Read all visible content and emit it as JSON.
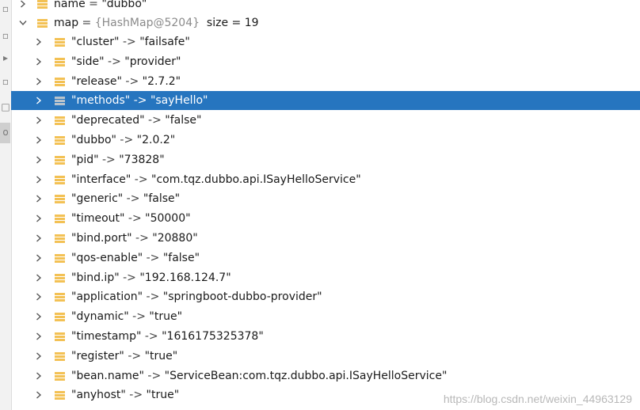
{
  "gutter": {
    "icons": [
      "◻",
      "▸",
      "▫",
      "□",
      "▢",
      "a",
      "o"
    ]
  },
  "top_row": {
    "name": "name",
    "sep": " = ",
    "value": "\"dubbo\""
  },
  "map_row": {
    "name": "map",
    "sep": " = ",
    "ref": "{HashMap@5204}",
    "size": "size = 19"
  },
  "entries": [
    {
      "key": "\"cluster\"",
      "value": "\"failsafe\""
    },
    {
      "key": "\"side\"",
      "value": "\"provider\""
    },
    {
      "key": "\"release\"",
      "value": "\"2.7.2\""
    },
    {
      "key": "\"methods\"",
      "value": "\"sayHello\""
    },
    {
      "key": "\"deprecated\"",
      "value": "\"false\""
    },
    {
      "key": "\"dubbo\"",
      "value": "\"2.0.2\""
    },
    {
      "key": "\"pid\"",
      "value": "\"73828\""
    },
    {
      "key": "\"interface\"",
      "value": "\"com.tqz.dubbo.api.ISayHelloService\""
    },
    {
      "key": "\"generic\"",
      "value": "\"false\""
    },
    {
      "key": "\"timeout\"",
      "value": "\"50000\""
    },
    {
      "key": "\"bind.port\"",
      "value": "\"20880\""
    },
    {
      "key": "\"qos-enable\"",
      "value": "\"false\""
    },
    {
      "key": "\"bind.ip\"",
      "value": "\"192.168.124.7\""
    },
    {
      "key": "\"application\"",
      "value": "\"springboot-dubbo-provider\""
    },
    {
      "key": "\"dynamic\"",
      "value": "\"true\""
    },
    {
      "key": "\"timestamp\"",
      "value": "\"1616175325378\""
    },
    {
      "key": "\"register\"",
      "value": "\"true\""
    },
    {
      "key": "\"bean.name\"",
      "value": "\"ServiceBean:com.tqz.dubbo.api.ISayHelloService\""
    },
    {
      "key": "\"anyhost\"",
      "value": "\"true\""
    }
  ],
  "arrow_sep": " -> ",
  "selected_index": 3,
  "colors": {
    "selection": "#2675bf",
    "field_icon": "#f3c154"
  },
  "watermark": "https://blog.csdn.net/weixin_44963129"
}
